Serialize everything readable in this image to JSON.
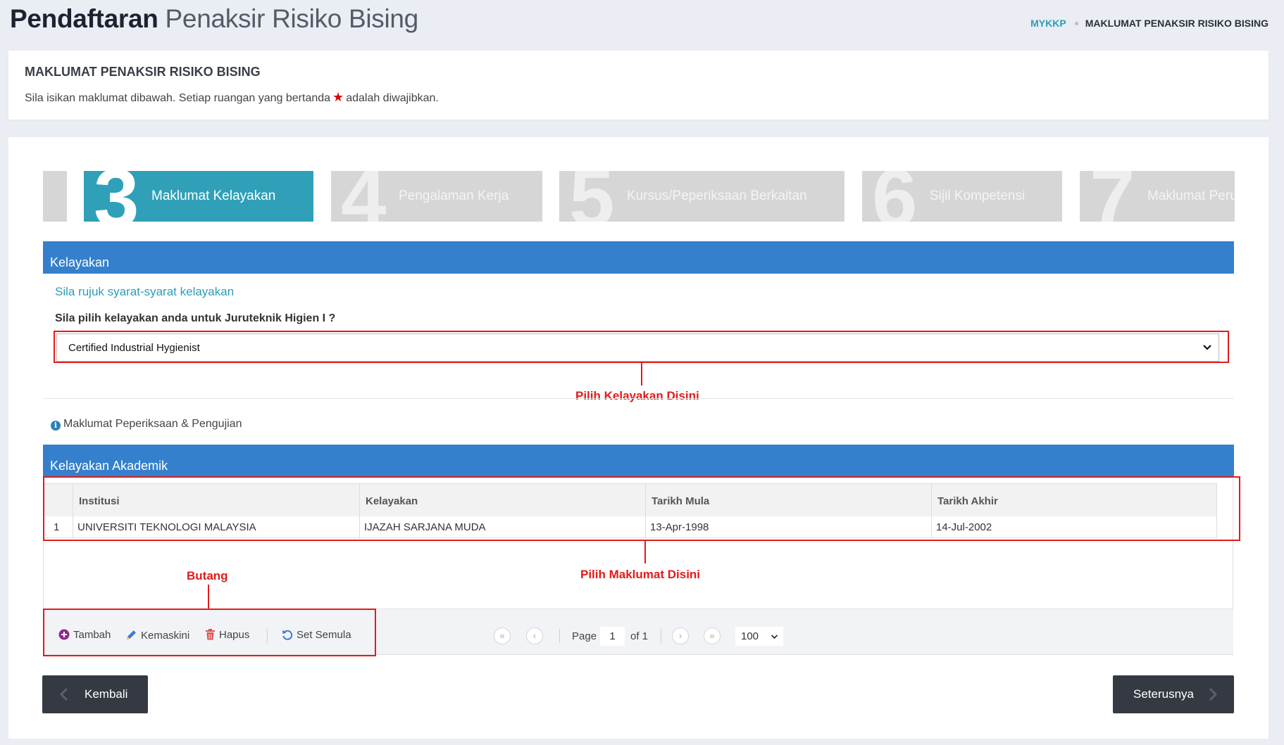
{
  "header": {
    "title_bold": "Pendaftaran",
    "title_light": "Penaksir Risiko Bising",
    "breadcrumb": [
      "MYKKP",
      "MAKLUMAT PENAKSIR RISIKO BISING"
    ]
  },
  "info": {
    "title": "MAKLUMAT PENAKSIR RISIKO BISING",
    "subtitle_before": "Sila isikan maklumat dibawah. Setiap ruangan yang bertanda",
    "subtitle_after": "adalah diwajibkan."
  },
  "steps": [
    {
      "num": "3",
      "label": "Maklumat Kelayakan",
      "active": true
    },
    {
      "num": "4",
      "label": "Pengalaman Kerja",
      "active": false
    },
    {
      "num": "5",
      "label": "Kursus/Peperiksaan Berkaitan",
      "active": false
    },
    {
      "num": "6",
      "label": "Sijil Kompetensi",
      "active": false
    },
    {
      "num": "7",
      "label": "Maklumat Peru",
      "active": false
    }
  ],
  "kelayakan": {
    "bar_title": "Kelayakan",
    "link": "Sila rujuk syarat-syarat kelayakan",
    "question": "Sila pilih kelayakan anda untuk Juruteknik Higien I ?",
    "selected": "Certified Industrial Hygienist"
  },
  "annotations": {
    "select_note": "Pilih Kelayakan Disini",
    "grid_note": "Pilih Maklumat Disini",
    "buttons_note": "Butang"
  },
  "exam_info": "Maklumat Peperiksaan & Pengujian",
  "academic": {
    "bar_title": "Kelayakan Akademik",
    "columns": [
      "Institusi",
      "Kelayakan",
      "Tarikh Mula",
      "Tarikh Akhir"
    ],
    "rows": [
      {
        "no": "1",
        "institusi": "UNIVERSITI TEKNOLOGI MALAYSIA",
        "kelayakan": "IJAZAH SARJANA MUDA",
        "mula": "13-Apr-1998",
        "akhir": "14-Jul-2002"
      }
    ]
  },
  "toolbar": {
    "add": "Tambah",
    "edit": "Kemaskini",
    "delete": "Hapus",
    "reset": "Set Semula"
  },
  "pager": {
    "first": "«",
    "prev": "‹",
    "next": "›",
    "last": "»",
    "page_label": "Page",
    "page": "1",
    "of_label": "of 1",
    "page_size": "100"
  },
  "nav": {
    "back": "Kembali",
    "next": "Seterusnya"
  },
  "colors": {
    "accent": "#2fa0b8",
    "bar": "#3480cc",
    "annotation": "#e21b1b",
    "dark_button": "#353a42"
  }
}
